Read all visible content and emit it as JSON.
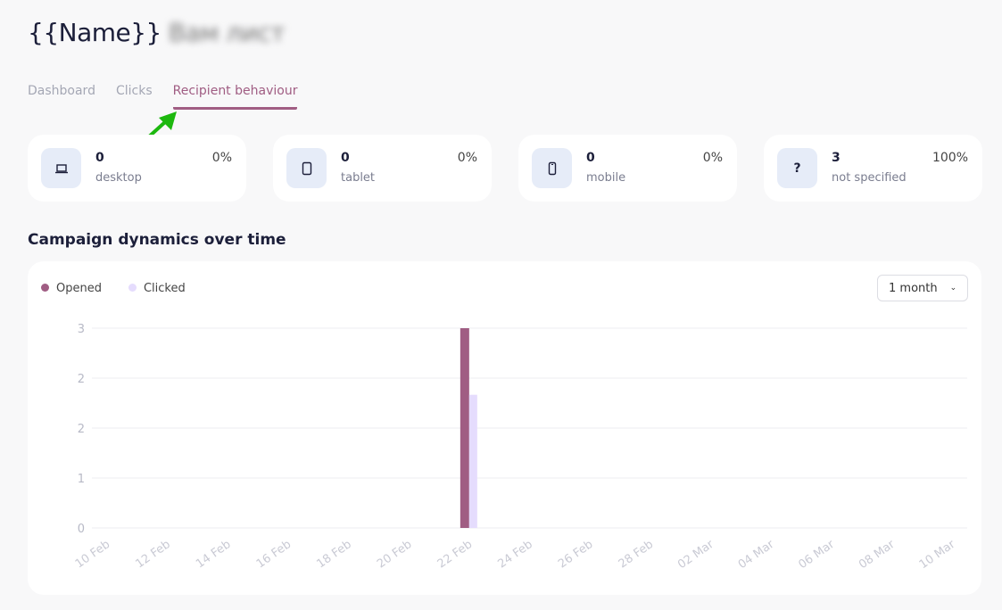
{
  "header": {
    "title": "{{Name}}",
    "title_blurred": "Вам лист"
  },
  "tabs": [
    {
      "label": "Dashboard"
    },
    {
      "label": "Clicks"
    },
    {
      "label": "Recipient behaviour",
      "active": true
    }
  ],
  "devices": [
    {
      "icon": "laptop-icon",
      "count": "0",
      "label": "desktop",
      "percent": "0%"
    },
    {
      "icon": "tablet-icon",
      "count": "0",
      "label": "tablet",
      "percent": "0%"
    },
    {
      "icon": "mobile-icon",
      "count": "0",
      "label": "mobile",
      "percent": "0%"
    },
    {
      "icon": "question-icon",
      "glyph": "?",
      "count": "3",
      "label": "not specified",
      "percent": "100%"
    }
  ],
  "section_title": "Campaign dynamics over time",
  "period_select": {
    "value": "1 month"
  },
  "colors": {
    "accent": "#a05d83",
    "clicked": "#e5dcfd",
    "annotation_arrow": "#1db80f"
  },
  "chart_data": {
    "type": "bar",
    "legend": [
      {
        "name": "Opened",
        "color": "#a05d83"
      },
      {
        "name": "Clicked",
        "color": "#e5dcfd"
      }
    ],
    "legend_placement": "top-left",
    "ylim": [
      0,
      3
    ],
    "y_ticks": [
      "0",
      "1",
      "2",
      "2",
      "3"
    ],
    "grid": true,
    "x_tick_labels": [
      "10 Feb",
      "12 Feb",
      "14 Feb",
      "16 Feb",
      "18 Feb",
      "20 Feb",
      "22 Feb",
      "24 Feb",
      "26 Feb",
      "28 Feb",
      "02 Mar",
      "04 Mar",
      "06 Mar",
      "08 Mar",
      "10 Mar"
    ],
    "categories": [
      "10 Feb",
      "11 Feb",
      "12 Feb",
      "13 Feb",
      "14 Feb",
      "15 Feb",
      "16 Feb",
      "17 Feb",
      "18 Feb",
      "19 Feb",
      "20 Feb",
      "21 Feb",
      "22 Feb",
      "23 Feb",
      "24 Feb",
      "25 Feb",
      "26 Feb",
      "27 Feb",
      "28 Feb",
      "01 Mar",
      "02 Mar",
      "03 Mar",
      "04 Mar",
      "05 Mar",
      "06 Mar",
      "07 Mar",
      "08 Mar",
      "09 Mar",
      "10 Mar"
    ],
    "series": [
      {
        "name": "Opened",
        "values": [
          0,
          0,
          0,
          0,
          0,
          0,
          0,
          0,
          0,
          0,
          0,
          0,
          3,
          0,
          0,
          0,
          0,
          0,
          0,
          0,
          0,
          0,
          0,
          0,
          0,
          0,
          0,
          0,
          0
        ]
      },
      {
        "name": "Clicked",
        "values": [
          0,
          0,
          0,
          0,
          0,
          0,
          0,
          0,
          0,
          0,
          0,
          0,
          2,
          0,
          0,
          0,
          0,
          0,
          0,
          0,
          0,
          0,
          0,
          0,
          0,
          0,
          0,
          0,
          0
        ]
      }
    ]
  }
}
